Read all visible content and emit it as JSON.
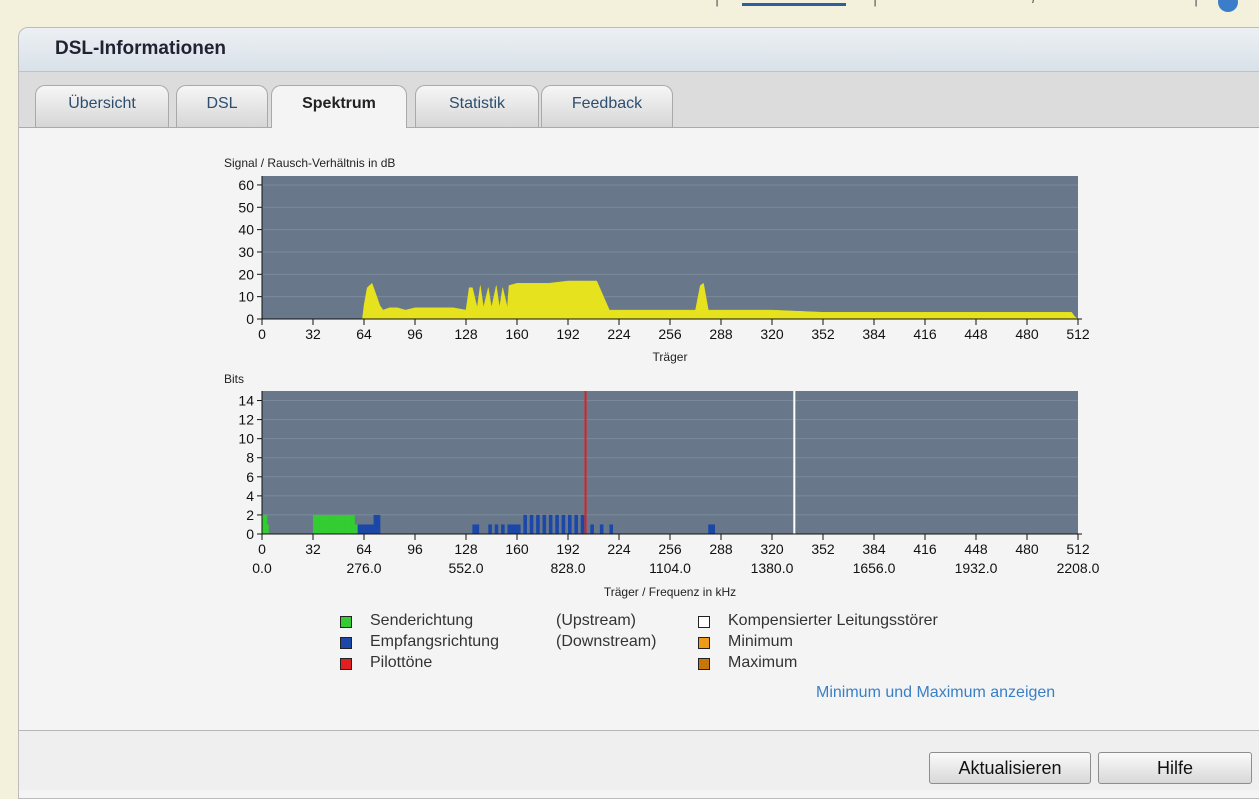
{
  "header": {
    "title": "DSL-Informationen"
  },
  "tabs": [
    {
      "label": "Übersicht",
      "active": false
    },
    {
      "label": "DSL",
      "active": false
    },
    {
      "label": "Spektrum",
      "active": true
    },
    {
      "label": "Statistik",
      "active": false
    },
    {
      "label": "Feedback",
      "active": false
    }
  ],
  "snr_chart": {
    "title": "Signal / Rausch-Verhältnis in dB",
    "xlabel": "Träger",
    "y_ticks": [
      "60",
      "50",
      "40",
      "30",
      "20",
      "10",
      "0"
    ],
    "x_ticks": [
      "0",
      "32",
      "64",
      "96",
      "128",
      "160",
      "192",
      "224",
      "256",
      "288",
      "320",
      "352",
      "384",
      "416",
      "448",
      "480",
      "512"
    ]
  },
  "bits_chart": {
    "title": "Bits",
    "xlabel": "Träger / Frequenz in kHz",
    "y_ticks": [
      "14",
      "12",
      "10",
      "8",
      "6",
      "4",
      "2",
      "0"
    ],
    "x_ticks": [
      "0",
      "32",
      "64",
      "96",
      "128",
      "160",
      "192",
      "224",
      "256",
      "288",
      "320",
      "352",
      "384",
      "416",
      "448",
      "480",
      "512"
    ],
    "freq_ticks": [
      "0.0",
      "276.0",
      "552.0",
      "828.0",
      "1104.0",
      "1380.0",
      "1656.0",
      "1932.0",
      "2208.0"
    ]
  },
  "chart_data": [
    {
      "type": "area",
      "title": "Signal / Rausch-Verhältnis in dB",
      "xlabel": "Träger",
      "ylabel": "",
      "xlim": [
        0,
        512
      ],
      "ylim": [
        0,
        64
      ],
      "series": [
        {
          "color": "#e6e21e",
          "x": [
            0,
            63,
            64,
            66,
            69,
            72,
            74,
            76,
            80,
            85,
            90,
            96,
            100,
            110,
            120,
            128,
            130,
            132,
            135,
            137,
            139,
            142,
            144,
            147,
            149,
            151,
            154,
            155,
            160,
            170,
            180,
            192,
            200,
            208,
            210,
            218,
            225,
            240,
            260,
            272,
            275,
            277,
            280,
            282,
            288,
            300,
            320,
            352,
            384,
            416,
            448,
            480,
            508,
            510,
            512
          ],
          "y": [
            0,
            0,
            6,
            14,
            16,
            10,
            6,
            4,
            5,
            5,
            4,
            5,
            5,
            5,
            5,
            4,
            14,
            14,
            5,
            15,
            5,
            14,
            5,
            15,
            5,
            14,
            5,
            15,
            16,
            16,
            16,
            17,
            17,
            17,
            17,
            4,
            4,
            4,
            4,
            4,
            15,
            16,
            4,
            4,
            4,
            4,
            4,
            3,
            3,
            3,
            3,
            3,
            3,
            1,
            0
          ]
        }
      ]
    },
    {
      "type": "bar",
      "title": "Bits",
      "xlabel": "Träger / Frequenz in kHz",
      "ylabel": "",
      "xlim": [
        0,
        512
      ],
      "ylim": [
        0,
        15
      ],
      "series": [
        {
          "name": "Senderichtung (Upstream)",
          "color": "#33cc33",
          "x": [
            0,
            1,
            2,
            32,
            34,
            36,
            38,
            40,
            42,
            44,
            46,
            48,
            50,
            52,
            54,
            56,
            58
          ],
          "y": [
            2,
            2,
            1,
            2,
            2,
            2,
            2,
            2,
            2,
            2,
            2,
            2,
            2,
            2,
            2,
            2,
            1
          ]
        },
        {
          "name": "Empfangsrichtung (Downstream)",
          "color": "#1a47a8",
          "x": [
            60,
            62,
            64,
            66,
            68,
            70,
            72,
            132,
            134,
            142,
            146,
            150,
            154,
            156,
            158,
            160,
            164,
            168,
            172,
            176,
            180,
            184,
            188,
            192,
            196,
            200,
            206,
            212,
            218,
            280,
            282
          ],
          "y": [
            1,
            1,
            1,
            1,
            1,
            2,
            2,
            1,
            1,
            1,
            1,
            1,
            1,
            1,
            1,
            1,
            2,
            2,
            2,
            2,
            2,
            2,
            2,
            2,
            2,
            2,
            1,
            1,
            1,
            1,
            1
          ]
        },
        {
          "name": "Pilottöne",
          "color": "#e02020",
          "x": [
            203
          ],
          "y": [
            15
          ]
        },
        {
          "name": "Kompensierter Leitungsstörer",
          "color": "#ffffff",
          "x": [
            334
          ],
          "y": [
            15
          ]
        }
      ]
    }
  ],
  "legend": {
    "upstream_label": "Senderichtung",
    "upstream_dir": "(Upstream)",
    "downstream_label": "Empfangsrichtung",
    "downstream_dir": "(Downstream)",
    "pilot_label": "Pilottöne",
    "crosstalk_label": "Kompensierter Leitungsstörer",
    "minimum_label": "Minimum",
    "maximum_label": "Maximum",
    "colors": {
      "upstream": "#33cc33",
      "downstream": "#1a47a8",
      "pilot": "#e02020",
      "crosstalk": "#ffffff",
      "minimum": "#f09a1a",
      "maximum": "#c8760a"
    }
  },
  "minmax_link": "Minimum und Maximum anzeigen",
  "buttons": {
    "refresh": "Aktualisieren",
    "help": "Hilfe"
  }
}
